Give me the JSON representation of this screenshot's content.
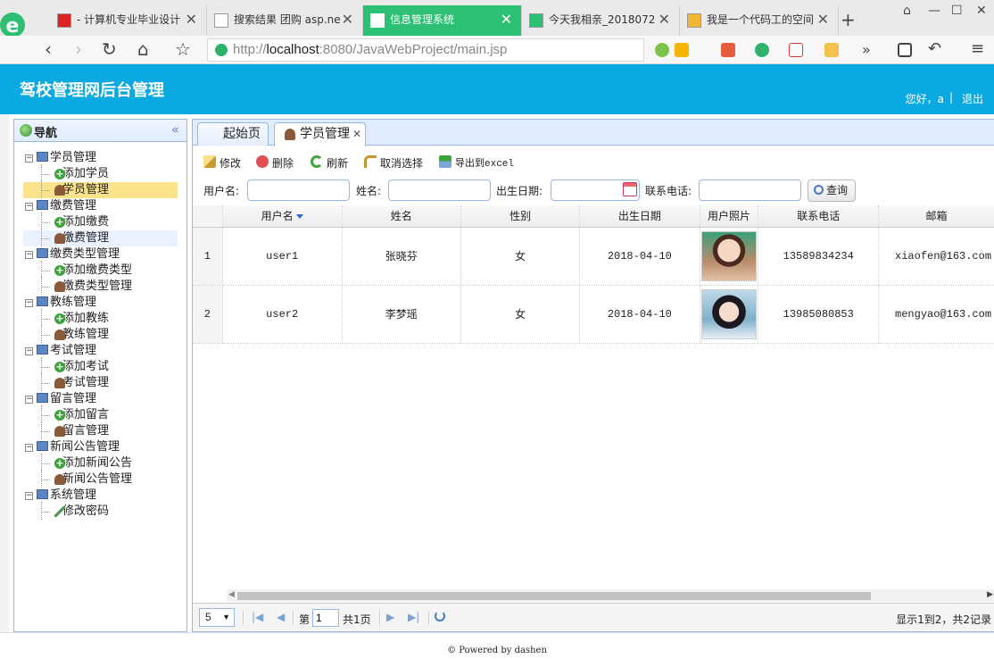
{
  "browser": {
    "tabs": [
      {
        "label": "- 计算机专业毕业设计",
        "active": false,
        "icon": "flag-icon"
      },
      {
        "label": "搜索结果 团购 asp.ne",
        "active": false,
        "icon": "page-icon"
      },
      {
        "label": "信息管理系统",
        "active": true,
        "icon": "page-icon"
      },
      {
        "label": "今天我相亲_2018072",
        "active": false,
        "icon": "video-icon"
      },
      {
        "label": "我是一个代码工的空间",
        "active": false,
        "icon": "star-icon"
      }
    ],
    "url_scheme": "http://",
    "url_host": "localhost",
    "url_rest": ":8080/JavaWebProject/main.jsp"
  },
  "header": {
    "title": "驾校管理网后台管理",
    "greeting": "您好，a",
    "separator": "|",
    "logout": "退出"
  },
  "nav": {
    "title": "导航",
    "collapse": "«",
    "groups": [
      {
        "label": "学员管理",
        "items": [
          {
            "label": "添加学员",
            "icon": "add"
          },
          {
            "label": "学员管理",
            "icon": "user",
            "state": "selected"
          }
        ]
      },
      {
        "label": "缴费管理",
        "items": [
          {
            "label": "添加缴费",
            "icon": "add"
          },
          {
            "label": "缴费管理",
            "icon": "user",
            "state": "hover"
          }
        ]
      },
      {
        "label": "缴费类型管理",
        "items": [
          {
            "label": "添加缴费类型",
            "icon": "add"
          },
          {
            "label": "缴费类型管理",
            "icon": "user"
          }
        ]
      },
      {
        "label": "教练管理",
        "items": [
          {
            "label": "添加教练",
            "icon": "add"
          },
          {
            "label": "教练管理",
            "icon": "user"
          }
        ]
      },
      {
        "label": "考试管理",
        "items": [
          {
            "label": "添加考试",
            "icon": "add"
          },
          {
            "label": "考试管理",
            "icon": "user"
          }
        ]
      },
      {
        "label": "留言管理",
        "items": [
          {
            "label": "添加留言",
            "icon": "add"
          },
          {
            "label": "留言管理",
            "icon": "user"
          }
        ]
      },
      {
        "label": "新闻公告管理",
        "items": [
          {
            "label": "添加新闻公告",
            "icon": "add"
          },
          {
            "label": "新闻公告管理",
            "icon": "user"
          }
        ]
      },
      {
        "label": "系统管理",
        "items": [
          {
            "label": "修改密码",
            "icon": "pen"
          }
        ]
      }
    ]
  },
  "main": {
    "tabs": [
      {
        "label": "起始页",
        "active": false
      },
      {
        "label": "学员管理",
        "active": true,
        "closable": true
      }
    ],
    "toolbar": {
      "edit": "修改",
      "delete": "删除",
      "refresh": "刷新",
      "cancel_select": "取消选择",
      "export": "导出到excel"
    },
    "search": {
      "username_label": "用户名:",
      "name_label": "姓名:",
      "birth_label": "出生日期:",
      "phone_label": "联系电话:",
      "query_button": "查询",
      "username_value": "",
      "name_value": "",
      "birth_value": "",
      "phone_value": ""
    },
    "grid": {
      "columns": [
        "用户名",
        "姓名",
        "性别",
        "出生日期",
        "用户照片",
        "联系电话",
        "邮箱"
      ],
      "sorted_column": "用户名",
      "rows": [
        {
          "num": "1",
          "username": "user1",
          "name": "张晓芬",
          "gender": "女",
          "birth": "2018-04-10",
          "photo": "photo-girl-1",
          "phone": "13589834234",
          "email": "xiaofen@163.com"
        },
        {
          "num": "2",
          "username": "user2",
          "name": "李梦瑶",
          "gender": "女",
          "birth": "2018-04-10",
          "photo": "photo-girl-2",
          "phone": "13985080853",
          "email": "mengyao@163.com"
        }
      ]
    },
    "pager": {
      "page_size": "5",
      "page_word": "第",
      "page_number": "1",
      "total_pages": "共1页",
      "info": "显示1到2，共2记录"
    }
  },
  "footer": {
    "text": "© Powered by dashen"
  }
}
